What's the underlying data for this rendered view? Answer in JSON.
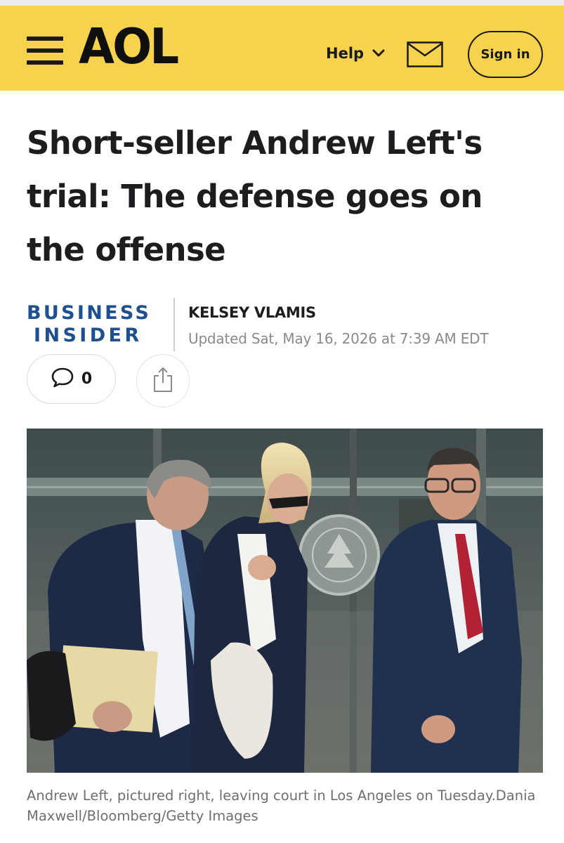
{
  "header": {
    "logo": "AOL",
    "help_label": "Help",
    "signin_label": "Sign in",
    "icons": {
      "menu": "hamburger-menu-icon",
      "mail": "mail-envelope-icon",
      "help_chevron": "chevron-down-icon"
    },
    "colors": {
      "background": "#f7d24c",
      "text": "#1a1a1a"
    }
  },
  "article": {
    "headline": "Short-seller Andrew Left's trial: The defense goes on the offense",
    "source_line1": "BUSINESS",
    "source_line2": "INSIDER",
    "source_color": "#1e4f8e",
    "author": "KELSEY VLAMIS",
    "updated": "Updated Sat, May 16, 2026 at 7:39 AM EDT",
    "comment_count": "0",
    "icons": {
      "comments": "speech-bubble-icon",
      "share": "share-icon"
    },
    "image": {
      "subject": "Three people in suits walking out of a courthouse"
    },
    "caption": "Andrew Left, pictured right, leaving court in Los Angeles on Tuesday.Dania Maxwell/Bloomberg/Getty Images"
  }
}
